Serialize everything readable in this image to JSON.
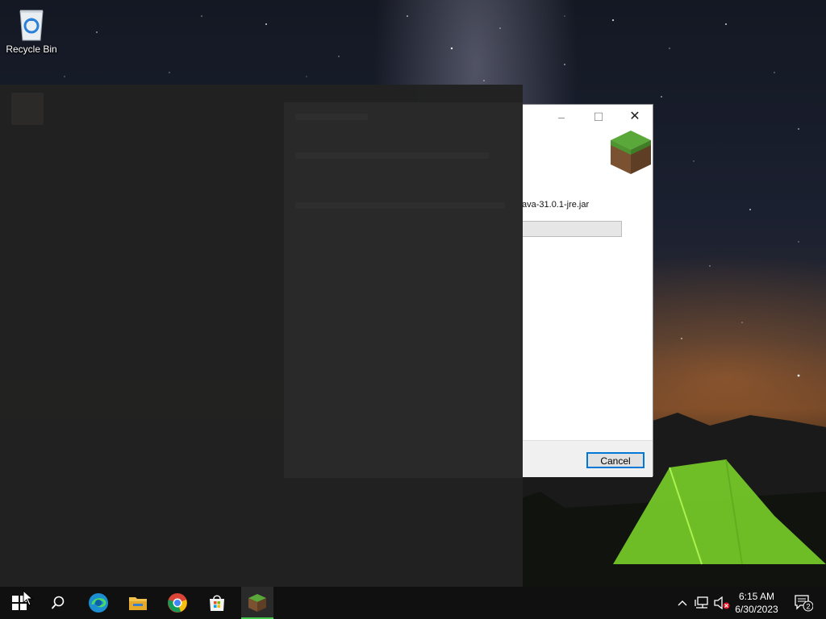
{
  "desktop": {
    "icons": [
      {
        "name": "recycle-bin",
        "label": "Recycle Bin"
      }
    ]
  },
  "installer": {
    "file_text": "ava-31.0.1-jre.jar",
    "cancel_label": "Cancel",
    "progress_fraction": 0.0
  },
  "taskbar": {
    "apps": [
      {
        "name": "start-button",
        "icon": "windows-logo-icon"
      },
      {
        "name": "search-button",
        "icon": "search-icon"
      },
      {
        "name": "edge-button",
        "icon": "edge-icon"
      },
      {
        "name": "file-explorer-button",
        "icon": "folder-icon"
      },
      {
        "name": "chrome-button",
        "icon": "chrome-icon"
      },
      {
        "name": "store-button",
        "icon": "store-icon"
      },
      {
        "name": "minecraft-button",
        "icon": "grass-block-icon",
        "active": true
      }
    ],
    "clock": {
      "time": "6:15 AM",
      "date": "6/30/2023"
    },
    "notification_count": "2"
  },
  "colors": {
    "accent_green": "#42c84a",
    "button_focus": "#0078d7",
    "taskbar": "#101010"
  }
}
